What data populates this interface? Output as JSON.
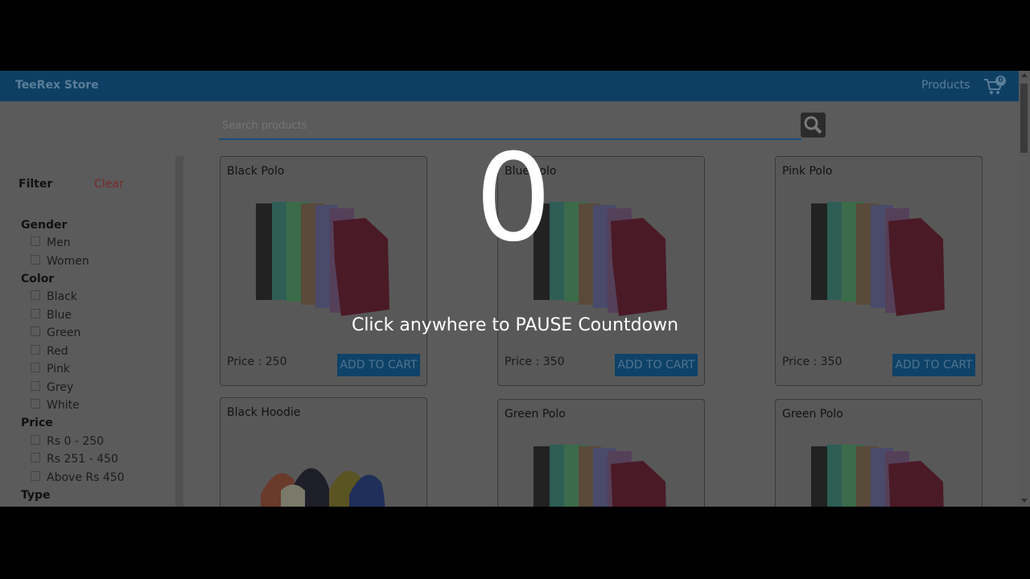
{
  "navbar": {
    "brand": "TeeRex Store",
    "products_link": "Products",
    "cart_count": "0"
  },
  "search": {
    "placeholder": "Search products"
  },
  "filter": {
    "title": "Filter",
    "clear": "Clear",
    "groups": [
      {
        "label": "Gender",
        "options": [
          "Men",
          "Women"
        ]
      },
      {
        "label": "Color",
        "options": [
          "Black",
          "Blue",
          "Green",
          "Red",
          "Pink",
          "Grey",
          "White"
        ]
      },
      {
        "label": "Price",
        "options": [
          "Rs 0 - 250",
          "Rs 251 - 450",
          "Above Rs 450"
        ]
      },
      {
        "label": "Type"
      }
    ]
  },
  "products": [
    {
      "name": "Black Polo",
      "price": "Price : 250",
      "button": "ADD TO CART",
      "image": "polo-shirts"
    },
    {
      "name": "Blue Polo",
      "price": "Price : 350",
      "button": "ADD TO CART",
      "image": "polo-shirts"
    },
    {
      "name": "Pink Polo",
      "price": "Price : 350",
      "button": "ADD TO CART",
      "image": "polo-shirts"
    },
    {
      "name": "Black Hoodie",
      "image": "hoodies"
    },
    {
      "name": "Green Polo",
      "image": "polo-shirts"
    },
    {
      "name": "Green Polo",
      "image": "polo-shirts"
    }
  ],
  "overlay": {
    "countdown": "0",
    "message": "Click anywhere to PAUSE Countdown"
  },
  "colors": {
    "navbar": "#0e3f63",
    "button": "#0f4267",
    "overlay_text": "#ffffff"
  }
}
